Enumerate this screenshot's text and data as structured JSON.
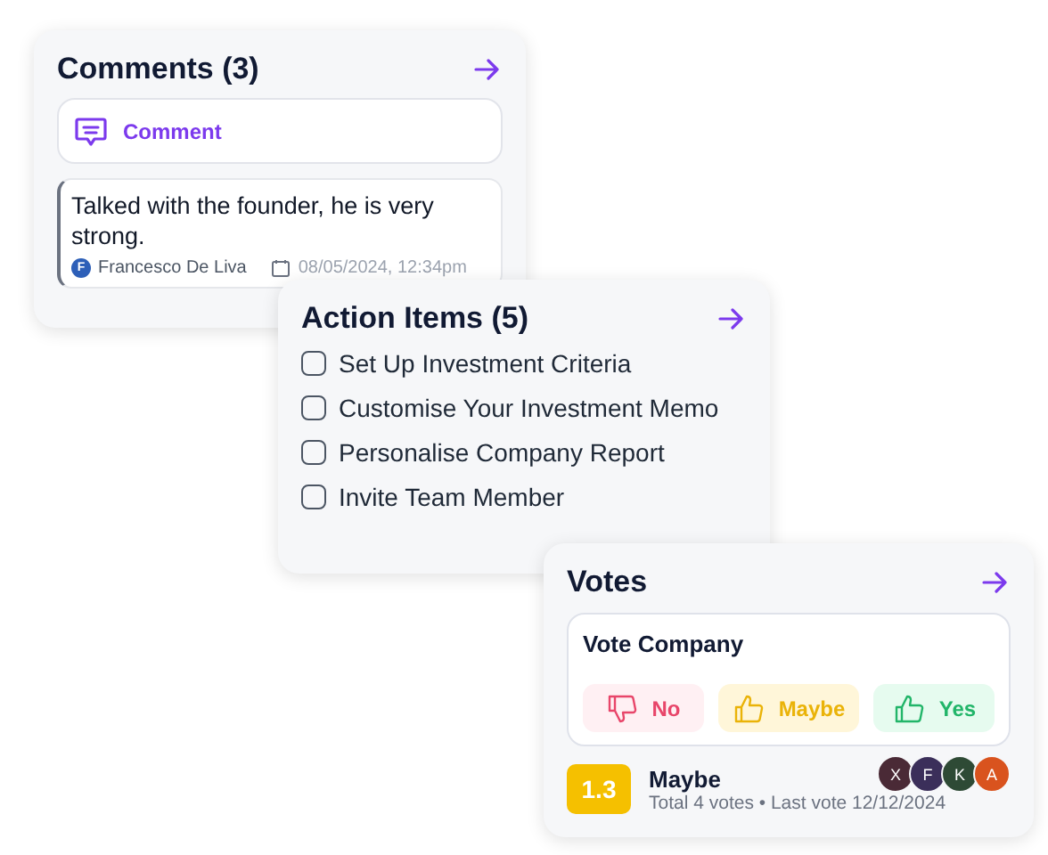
{
  "comments": {
    "title": "Comments (3)",
    "add_button": "Comment",
    "items": [
      {
        "text": "Talked with the founder, he is very strong.",
        "author_initial": "F",
        "author": "Francesco De Liva",
        "date": "08/05/2024, 12:34pm"
      }
    ]
  },
  "action_items": {
    "title": "Action Items (5)",
    "items": [
      {
        "label": "Set Up Investment Criteria",
        "checked": false
      },
      {
        "label": "Customise Your Investment Memo",
        "checked": false
      },
      {
        "label": "Personalise Company Report",
        "checked": false
      },
      {
        "label": "Invite Team Member",
        "checked": false
      }
    ]
  },
  "votes": {
    "title": "Votes",
    "prompt": "Vote Company",
    "options": [
      {
        "kind": "no",
        "label": "No"
      },
      {
        "kind": "maybe",
        "label": "Maybe"
      },
      {
        "kind": "yes",
        "label": "Yes"
      }
    ],
    "score": "1.3",
    "result": "Maybe",
    "summary": "Total 4 votes • Last vote 12/12/2024",
    "voters": [
      {
        "initial": "X",
        "color": "#4a2a36"
      },
      {
        "initial": "F",
        "color": "#3b2f5a"
      },
      {
        "initial": "K",
        "color": "#2e4a35"
      },
      {
        "initial": "A",
        "color": "#d9531e"
      }
    ]
  }
}
